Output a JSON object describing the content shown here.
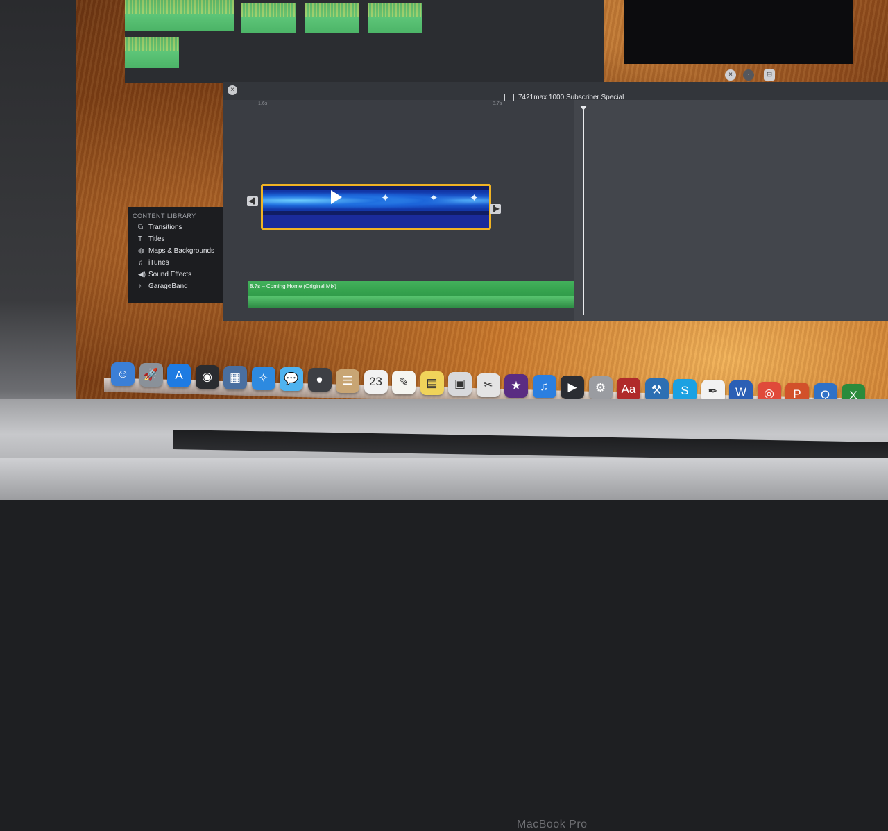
{
  "device": {
    "brand": "MacBook Pro"
  },
  "tooltip": {
    "text": ""
  },
  "library": {
    "header": "CONTENT LIBRARY",
    "items": [
      {
        "label": "Transitions",
        "icon": "transitions-icon",
        "glyph": "⧉"
      },
      {
        "label": "Titles",
        "icon": "titles-icon",
        "glyph": "T"
      },
      {
        "label": "Maps & Backgrounds",
        "icon": "globe-icon",
        "glyph": "◍"
      },
      {
        "label": "iTunes",
        "icon": "music-note-icon",
        "glyph": "♫"
      },
      {
        "label": "Sound Effects",
        "icon": "speaker-icon",
        "glyph": "◀)"
      },
      {
        "label": "GarageBand",
        "icon": "guitar-icon",
        "glyph": "♪"
      }
    ]
  },
  "timeline": {
    "project_title": "7421max 1000 Subscriber Special",
    "ruler": [
      "1.6s",
      "8.7s"
    ],
    "close_glyph": "×",
    "audio_label": "8.7s – Coming Home (Original Mix)"
  },
  "viewer_controls": {
    "left_glyph": "×",
    "mid_glyph": "·",
    "right_glyph": "⊟"
  },
  "clip_icons": [
    "✦",
    "✦",
    "✦"
  ],
  "dock": [
    {
      "name": "finder-icon",
      "glyph": "☺",
      "color": "#3b7fd6"
    },
    {
      "name": "launchpad-icon",
      "glyph": "🚀",
      "color": "#8a9199"
    },
    {
      "name": "app-store-icon",
      "glyph": "A",
      "color": "#1e7be2"
    },
    {
      "name": "dashboard-icon",
      "glyph": "◉",
      "color": "#2a2c30"
    },
    {
      "name": "mission-control-icon",
      "glyph": "▦",
      "color": "#4a6fa0"
    },
    {
      "name": "safari-icon",
      "glyph": "✧",
      "color": "#2d8ae0"
    },
    {
      "name": "messages-icon",
      "glyph": "💬",
      "color": "#4fb3ef"
    },
    {
      "name": "facetime-icon",
      "glyph": "●",
      "color": "#3d3f44"
    },
    {
      "name": "contacts-icon",
      "glyph": "☰",
      "color": "#c8a574"
    },
    {
      "name": "calendar-icon",
      "glyph": "23",
      "color": "#f1f1f1"
    },
    {
      "name": "notes-icon",
      "glyph": "✎",
      "color": "#f5f5f0"
    },
    {
      "name": "stickies-icon",
      "glyph": "▤",
      "color": "#f0d35a"
    },
    {
      "name": "photos-icon",
      "glyph": "▣",
      "color": "#d8d9dc"
    },
    {
      "name": "preview-icon",
      "glyph": "✂",
      "color": "#e4e4e4"
    },
    {
      "name": "imovie-icon",
      "glyph": "★",
      "color": "#5a2c82"
    },
    {
      "name": "itunes-icon",
      "glyph": "♫",
      "color": "#2b7fe0"
    },
    {
      "name": "final-cut-icon",
      "glyph": "▶",
      "color": "#2b2d33"
    },
    {
      "name": "system-preferences-icon",
      "glyph": "⚙",
      "color": "#9a9ca1"
    },
    {
      "name": "dictionary-icon",
      "glyph": "Aa",
      "color": "#b02a2a"
    },
    {
      "name": "xcode-icon",
      "glyph": "⚒",
      "color": "#2c6fb3"
    },
    {
      "name": "skype-icon",
      "glyph": "S",
      "color": "#1ba1e2"
    },
    {
      "name": "textedit-icon",
      "glyph": "✒",
      "color": "#f2f2f2"
    },
    {
      "name": "word-icon",
      "glyph": "W",
      "color": "#2b5fb5"
    },
    {
      "name": "chrome-icon",
      "glyph": "◎",
      "color": "#e04a3a"
    },
    {
      "name": "powerpoint-icon",
      "glyph": "P",
      "color": "#d2512a"
    },
    {
      "name": "quicktime-icon",
      "glyph": "Q",
      "color": "#2f71c7"
    },
    {
      "name": "excel-icon",
      "glyph": "X",
      "color": "#2a8b3c"
    }
  ]
}
